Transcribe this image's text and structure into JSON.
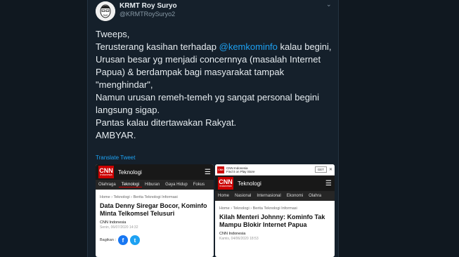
{
  "tweet": {
    "name": "KRMT Roy Suryo",
    "handle": "@KRMTRoySuryo2",
    "line1": "Tweeps,",
    "line2_pre": "Terusterang kasihan terhadap ",
    "mention": "@kemkominfo",
    "line2_post": " kalau begini,",
    "rest": "Urusan besar yg menjadi concernnya (masalah Internet Papua) & berdampak bagi masyarakat tampak \"menghindar\",\nNamun urusan remeh-temeh yg sangat personal begini langsung sigap.\nPantas kalau ditertawakan Rakyat.\nAMBYAR.",
    "translate": "Translate Tweet"
  },
  "card1": {
    "logo": "CNN",
    "logo_sub": "Indonesia",
    "section": "Teknologi",
    "nav": [
      "Olahraga",
      "Teknologi",
      "Hiburan",
      "Gaya Hidup",
      "Fokus"
    ],
    "breadcrumb": "Home › Teknologi › Berita Teknologi Informasi",
    "headline": "Data Denny Siregar Bocor, Kominfo Minta Telkomsel Telusuri",
    "source": "CNN Indonesia",
    "date": "Senin, 06/07/2020 14:32",
    "share_label": "Bagikan :"
  },
  "card2": {
    "store_title": "CNN Indonesia",
    "store_sub": "Find it on Play Store",
    "get": "GET",
    "logo": "CNN",
    "logo_sub": "Indonesia",
    "section": "Teknologi",
    "nav": [
      "Home",
      "Nasional",
      "Internasional",
      "Ekonomi",
      "Olahra"
    ],
    "breadcrumb": "Home › Teknologi › Berita Teknologi Informasi",
    "headline": "Kilah Menteri Johnny: Kominfo Tak Mampu Blokir Internet Papua",
    "source": "CNN Indonesia",
    "date": "Kamis, 04/06/2020 18:53"
  },
  "colors": {
    "background": "#15202b",
    "accent": "#1da1f2",
    "cnn_red": "#cc0000"
  }
}
